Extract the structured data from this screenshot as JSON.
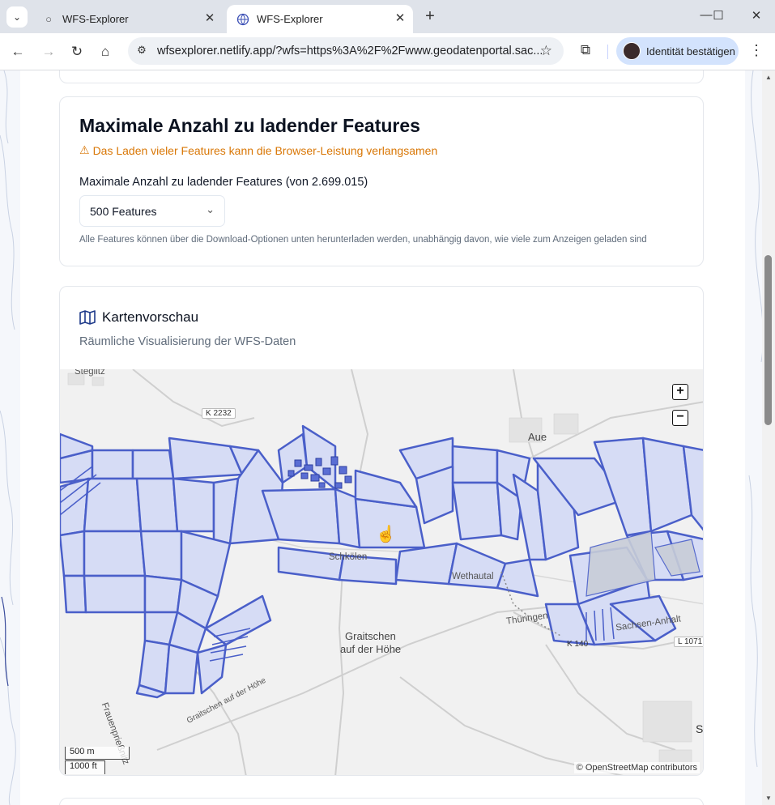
{
  "tabs": [
    {
      "title": "WFS-Explorer",
      "active": false,
      "icon": "globe-icon"
    },
    {
      "title": "WFS-Explorer",
      "active": true,
      "icon": "wfs-favicon-icon"
    }
  ],
  "address_bar": {
    "url": "wfsexplorer.netlify.app/?wfs=https%3A%2F%2Fwww.geodatenportal.sac..."
  },
  "profile": {
    "label": "Identität bestätigen"
  },
  "features_card": {
    "title": "Maximale Anzahl zu ladender Features",
    "warning": "Das Laden vieler Features kann die Browser-Leistung verlangsamen",
    "field_label": "Maximale Anzahl zu ladender Features (von 2.699.015)",
    "selected": "500 Features",
    "hint": "Alle Features können über die Download-Optionen unten herunterladen werden, unabhängig davon, wie viele zum Anzeigen geladen sind"
  },
  "map_card": {
    "title": "Kartenvorschau",
    "subtitle": "Räumliche Visualisierung der WFS-Daten",
    "zoom_in": "+",
    "zoom_out": "−",
    "attribution": "© OpenStreetMap contributors",
    "scale_metric": "500 m",
    "scale_imperial": "1000 ft",
    "place_labels": {
      "steglitz": "Steglitz",
      "aue": "Aue",
      "schkoelen": "Schkölen",
      "graitschen_1": "Graitschen",
      "graitschen_2": "auf der Höhe",
      "wethautal": "Wethautal",
      "thueringen": "Thüringen",
      "sachsen_anhalt": "Sachsen-Anhalt",
      "frauenprie": "Frauenprießnitz",
      "graitschen_road": "Graitschen auf der Höhe",
      "se": "Se"
    },
    "road_labels": {
      "k2232": "K 2232",
      "l1071": "L 1071",
      "k140": "K 140"
    },
    "colors": {
      "parcel_fill": "#d6dcf5",
      "parcel_stroke": "#4a5fc9"
    }
  }
}
